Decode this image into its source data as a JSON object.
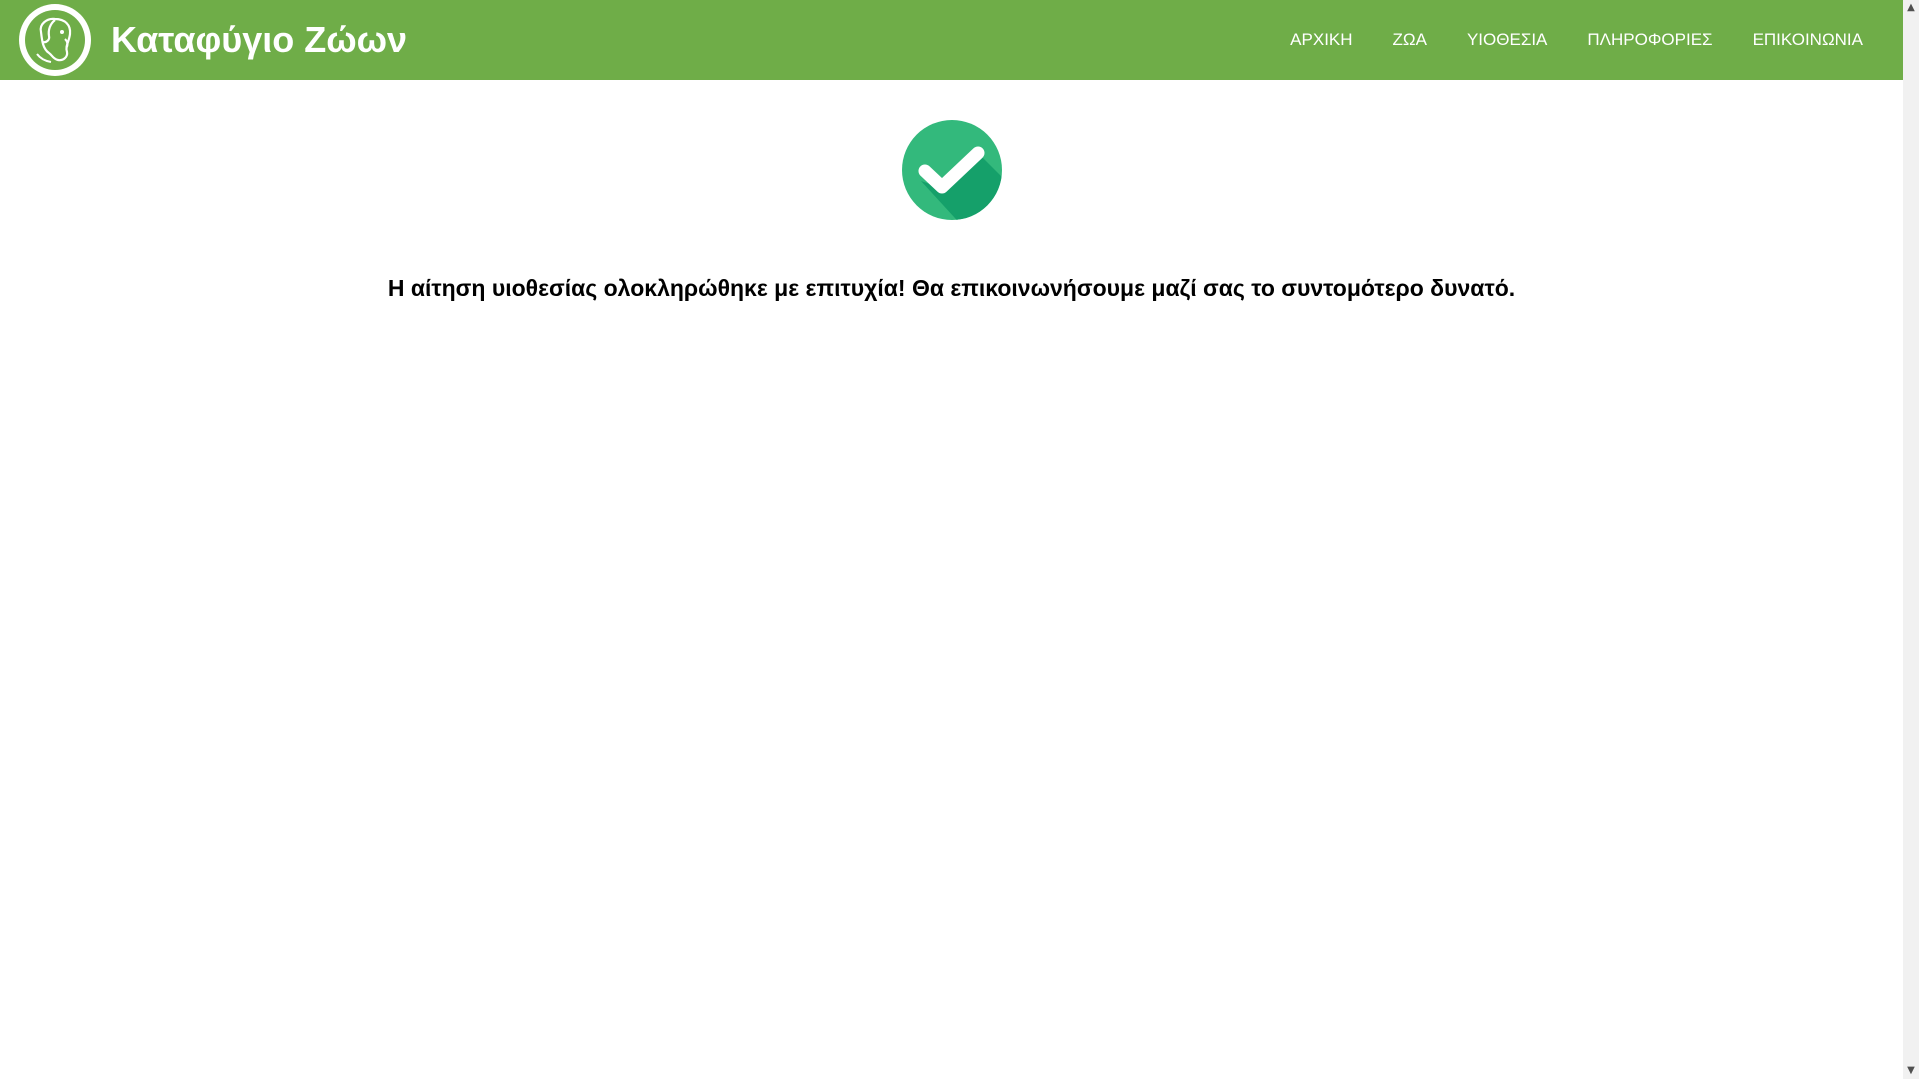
{
  "site": {
    "title": "Καταφύγιο Ζώων",
    "logo_icon": "dog-head-logo-icon"
  },
  "nav": {
    "items": [
      {
        "label": "ΑΡΧΙΚΗ"
      },
      {
        "label": "ΖΩΑ"
      },
      {
        "label": "ΥΙΟΘΕΣΙΑ"
      },
      {
        "label": "ΠΛΗΡΟΦΟΡΙΕΣ"
      },
      {
        "label": "ΕΠΙΚΟΙΝΩΝΙΑ"
      }
    ]
  },
  "confirmation": {
    "icon": "check-circle-icon",
    "message": "Η αίτηση υιοθεσίας ολοκληρώθηκε με επιτυχία! Θα επικοινωνήσουμε μαζί σας το συντομότερο δυνατό."
  },
  "colors": {
    "navbar": "#6fad48",
    "check_light": "#33b97c",
    "check_dark": "#15a06a",
    "text": "#000000"
  }
}
